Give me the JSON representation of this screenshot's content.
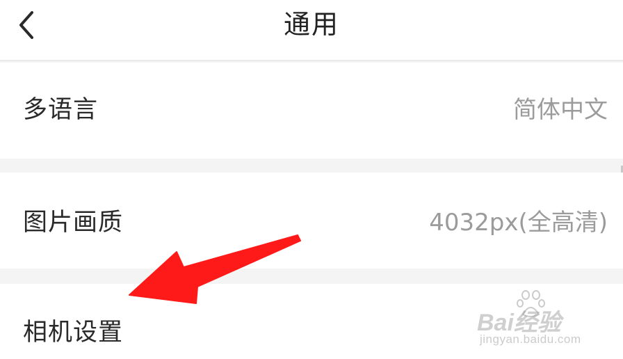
{
  "nav": {
    "back_icon": "chevron-left-icon",
    "title": "通用"
  },
  "settings": {
    "language": {
      "label": "多语言",
      "value": "简体中文"
    },
    "image_quality": {
      "label": "图片画质",
      "value": "4032px(全高清)"
    },
    "camera": {
      "label": "相机设置"
    }
  },
  "annotation": {
    "arrow_icon": "red-arrow-pointer",
    "color": "#ff1a1a"
  },
  "watermark": {
    "logo_text": "Bai经验",
    "subtitle": "jingyan.baidu.com"
  },
  "colors": {
    "background": "#f4f4f4",
    "row_background": "#ffffff",
    "label": "#2a2a2a",
    "value": "#9b9b9b"
  }
}
